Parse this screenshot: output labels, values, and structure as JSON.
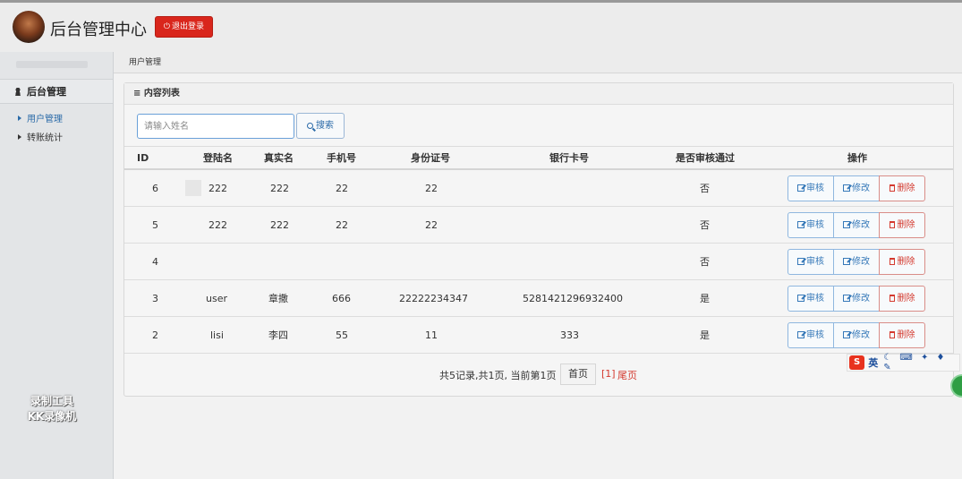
{
  "header": {
    "app_title": "后台管理中心",
    "logout_label": "退出登录",
    "logout_color": "#d9261c"
  },
  "sidebar": {
    "section_label": "后台管理",
    "items": [
      {
        "label": "用户管理",
        "active": true
      },
      {
        "label": "转账统计",
        "active": false
      }
    ]
  },
  "watermark": {
    "line1": "录制工具",
    "line2": "KK录像机"
  },
  "breadcrumb": {
    "current": "用户管理"
  },
  "panel": {
    "title": "≡ 内容列表"
  },
  "search": {
    "placeholder": "请输入姓名",
    "button_label": "搜索"
  },
  "table": {
    "columns": [
      "ID",
      "登陆名",
      "真实名",
      "手机号",
      "身份证号",
      "银行卡号",
      "是否审核通过",
      "操作"
    ],
    "rows": [
      {
        "id": "6",
        "login": "222",
        "real_name": "222",
        "phone": "22",
        "id_card": "22",
        "bank_card": "",
        "audited": "否"
      },
      {
        "id": "5",
        "login": "222",
        "real_name": "222",
        "phone": "22",
        "id_card": "22",
        "bank_card": "",
        "audited": "否"
      },
      {
        "id": "4",
        "login": "",
        "real_name": "",
        "phone": "",
        "id_card": "",
        "bank_card": "",
        "audited": "否"
      },
      {
        "id": "3",
        "login": "user",
        "real_name": "章撒",
        "phone": "666",
        "id_card": "22222234347",
        "bank_card": "5281421296932400",
        "audited": "是"
      },
      {
        "id": "2",
        "login": "lisi",
        "real_name": "李四",
        "phone": "55",
        "id_card": "11",
        "bank_card": "333",
        "audited": "是"
      }
    ],
    "actions": {
      "audit": "审核",
      "edit": "修改",
      "delete": "删除"
    }
  },
  "pagination": {
    "info": "共5记录,共1页, 当前第1页",
    "first": "首页",
    "current": "[1]",
    "last": "尾页"
  },
  "ime": {
    "logo": "S",
    "lang": "英"
  },
  "colors": {
    "primary": "#2a6aa8",
    "danger": "#d43a2f"
  }
}
